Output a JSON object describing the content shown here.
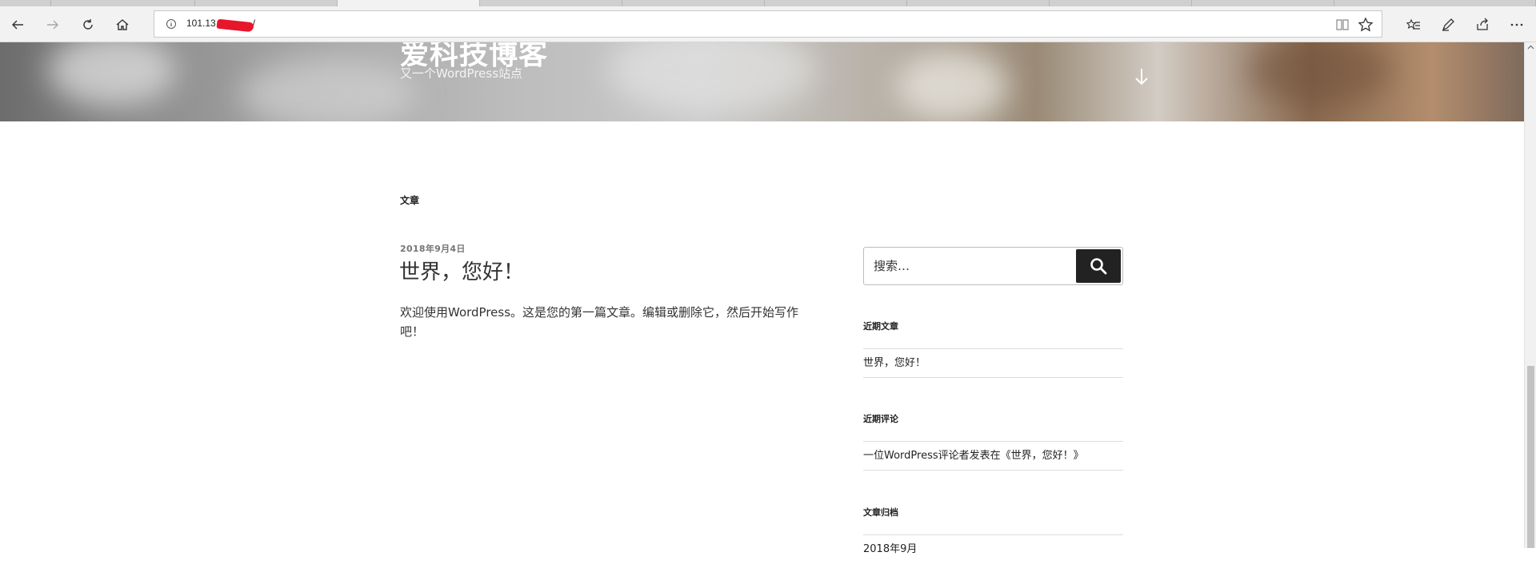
{
  "browser": {
    "url": "101.13",
    "url_tail": "/"
  },
  "header": {
    "site_title": "爱科技博客",
    "site_description": "又一个WordPress站点"
  },
  "content": {
    "page_heading": "文章",
    "post": {
      "date": "2018年9月4日",
      "title": "世界，您好！",
      "excerpt": "欢迎使用WordPress。这是您的第一篇文章。编辑或删除它，然后开始写作吧！"
    }
  },
  "sidebar": {
    "search_placeholder": "搜索…",
    "recent_posts": {
      "title": "近期文章",
      "items": [
        "世界，您好！"
      ]
    },
    "recent_comments": {
      "title": "近期评论",
      "items": [
        "一位WordPress评论者发表在《世界，您好！》"
      ]
    },
    "archives": {
      "title": "文章归档",
      "items": [
        "2018年9月"
      ]
    }
  },
  "colors": {
    "search_button": "#222222",
    "text": "#222222",
    "date": "#767676",
    "redaction": "#e8162a"
  }
}
